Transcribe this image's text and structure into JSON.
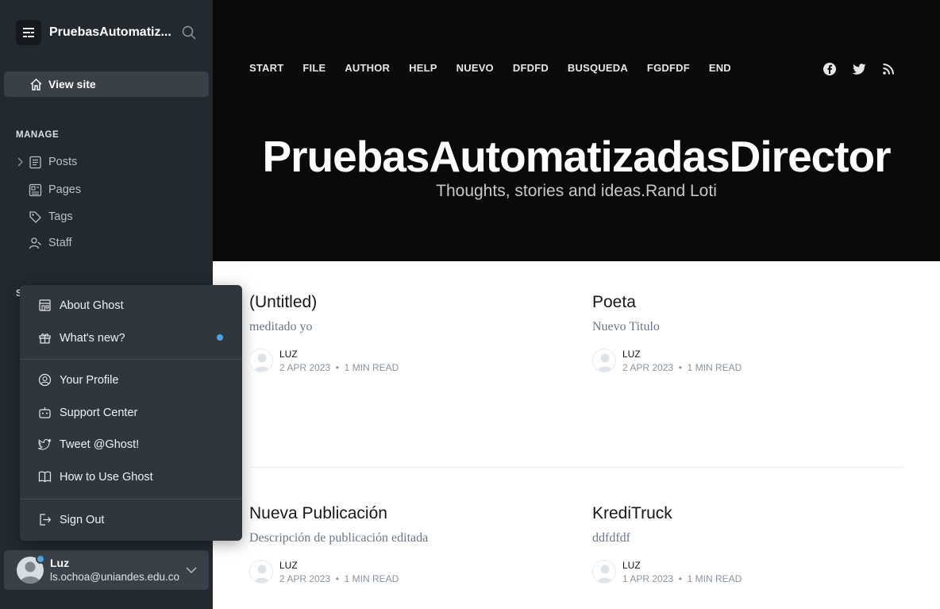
{
  "sidebar": {
    "brand_title": "PruebasAutomatiz...",
    "view_site_label": "View site",
    "manage_label": "MANAGE",
    "settings_label_partial": "S",
    "nav": {
      "posts": "Posts",
      "pages": "Pages",
      "tags": "Tags",
      "staff": "Staff"
    },
    "user": {
      "name": "Luz",
      "email": "ls.ochoa@uniandes.edu.co"
    }
  },
  "menu": {
    "about": "About Ghost",
    "whats_new": "What's new?",
    "your_profile": "Your Profile",
    "support": "Support Center",
    "tweet": "Tweet @Ghost!",
    "how_to": "How to Use Ghost",
    "sign_out": "Sign Out"
  },
  "site": {
    "nav": [
      "START",
      "FILE",
      "AUTHOR",
      "HELP",
      "NUEVO",
      "DFDFD",
      "BUSQUEDA",
      "FGDFDF",
      "END"
    ],
    "title": "PruebasAutomatizadasDirector",
    "description": "Thoughts, stories and ideas.Rand Loti",
    "posts": [
      {
        "title": "(Untitled)",
        "excerpt": "meditado yo",
        "author": "LUZ",
        "date": "2 APR 2023",
        "read": "1 MIN READ"
      },
      {
        "title": "Poeta",
        "excerpt": "Nuevo Titulo",
        "author": "LUZ",
        "date": "2 APR 2023",
        "read": "1 MIN READ"
      },
      {
        "title": "Nueva Publicación",
        "excerpt": "Descripción de publicación editada",
        "author": "LUZ",
        "date": "2 APR 2023",
        "read": "1 MIN READ"
      },
      {
        "title": "KrediTruck",
        "excerpt": "ddfdfdf",
        "author": "LUZ",
        "date": "1 APR 2023",
        "read": "1 MIN READ"
      }
    ]
  },
  "colors": {
    "sidebar_bg": "#222a30",
    "menu_bg": "#2f373e",
    "accent_dot": "#4fa3e0",
    "hero_bg": "#0a0a0a"
  }
}
